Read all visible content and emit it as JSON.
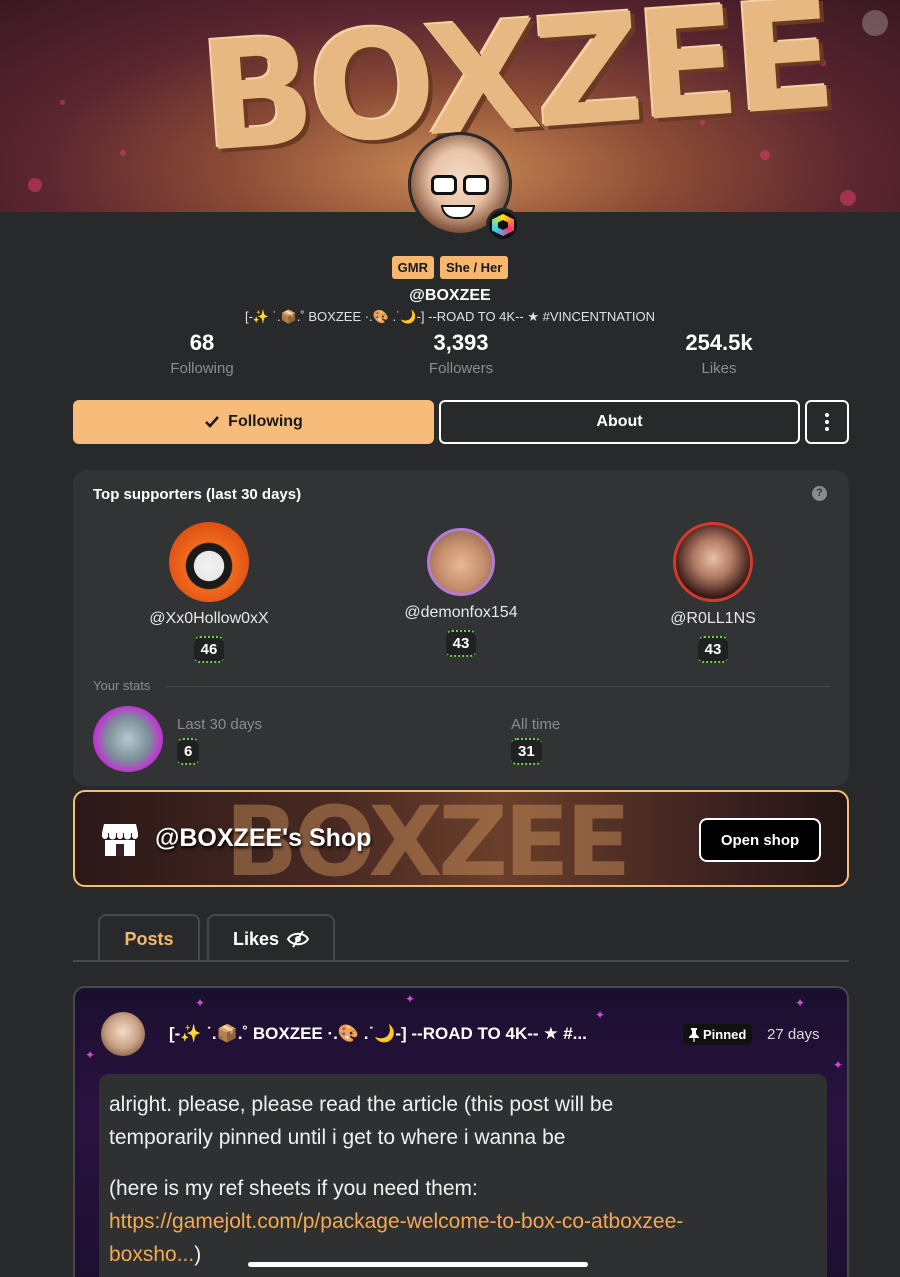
{
  "banner": {
    "logo_text": "BOXZEE"
  },
  "profile": {
    "tags": [
      "GMR",
      "She / Her"
    ],
    "username": "@BOXZEE",
    "bio": "[-✨ ˙.📦.˚ BOXZEE ·.🎨 .˙🌙-] --ROAD TO 4K-- ★ #VINCENTNATION",
    "stats": [
      {
        "value": "68",
        "label": "Following"
      },
      {
        "value": "3,393",
        "label": "Followers"
      },
      {
        "value": "254.5k",
        "label": "Likes"
      }
    ]
  },
  "actions": {
    "following_label": "Following",
    "about_label": "About"
  },
  "supporters": {
    "title": "Top supporters (last 30 days)",
    "help": "?",
    "items": [
      {
        "name": "@Xx0Hollow0xX",
        "count": "46"
      },
      {
        "name": "@demonfox154",
        "count": "43"
      },
      {
        "name": "@R0LL1NS",
        "count": "43"
      }
    ],
    "your_stats_label": "Your stats",
    "last30_label": "Last 30 days",
    "last30_value": "6",
    "alltime_label": "All time",
    "alltime_value": "31"
  },
  "shop": {
    "title": "@BOXZEE's Shop",
    "button": "Open shop"
  },
  "tabs": {
    "posts": "Posts",
    "likes": "Likes"
  },
  "post": {
    "author": "[-✨ ˙.📦.˚ BOXZEE ·.🎨 .˙🌙-] --ROAD TO 4K-- ★ #...",
    "pinned": "Pinned",
    "age": "27 days",
    "line1": "alright. please, please read the article (this post will be",
    "line2": "temporarily pinned until i get to where i wanna be",
    "line3": "(here is my ref sheets if you need them:",
    "link1": "https://gamejolt.com/p/package-welcome-to-box-co-atboxzee-",
    "link2": "boxsho...",
    "link_tail": ")"
  },
  "colors": {
    "accent": "#f7b76f",
    "background": "#27292b",
    "card": "#313335"
  }
}
